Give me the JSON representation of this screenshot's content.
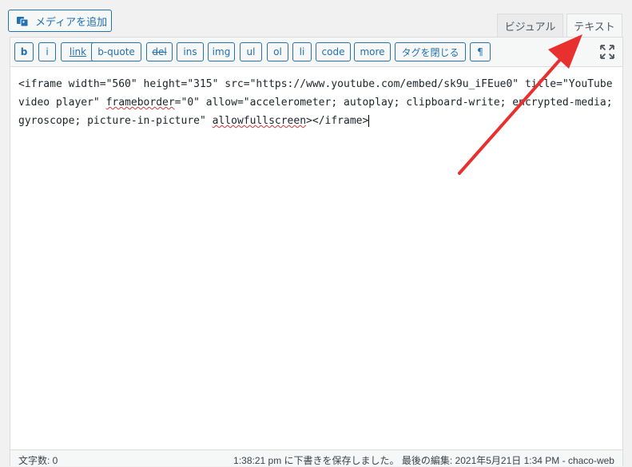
{
  "media_button": {
    "label": "メディアを追加",
    "icon": "media-icon"
  },
  "tabs": {
    "visual": "ビジュアル",
    "text": "テキスト"
  },
  "toolbar": {
    "buttons": [
      "b",
      "i",
      "link",
      "b-quote",
      "del",
      "ins",
      "img",
      "ul",
      "ol",
      "li",
      "code",
      "more",
      "タグを閉じる",
      "¶"
    ],
    "fullscreen_icon": "fullscreen-icon"
  },
  "content": {
    "part1": "<iframe width=\"560\" height=\"315\" src=\"https://www.youtube.com/embed/sk9u_iFEue0\" title=\"YouTube video player\" ",
    "word1": "frameborder",
    "part2": "=\"0\" allow=\"accelerometer; autoplay; clipboard-write; encrypted-media; gyroscope; picture-in-picture\" ",
    "word2": "allowfullscreen",
    "part3": "></iframe>"
  },
  "status": {
    "word_count": "文字数: 0",
    "draft_saved": "1:38:21 pm に下書きを保存しました。 最後の編集: 2021年5月21日 1:34 PM - chaco-web"
  },
  "colors": {
    "accent": "#2271b1",
    "annotation_arrow": "#e8302e"
  }
}
